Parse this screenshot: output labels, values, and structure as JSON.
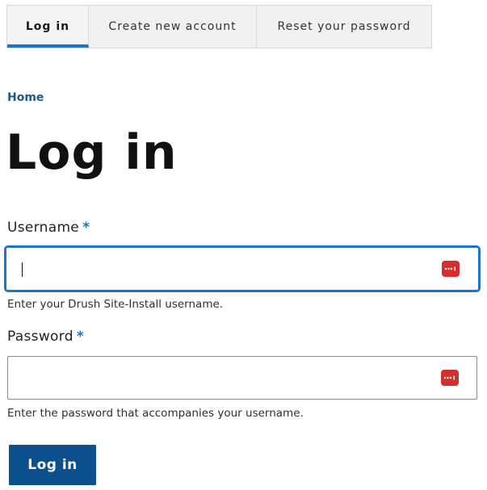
{
  "tabs": [
    {
      "label": "Log in",
      "active": true
    },
    {
      "label": "Create new account",
      "active": false
    },
    {
      "label": "Reset your password",
      "active": false
    }
  ],
  "breadcrumb": {
    "home_label": "Home"
  },
  "page_title": "Log in",
  "form": {
    "username": {
      "label": "Username",
      "required_marker": "*",
      "value": "",
      "description": "Enter your Drush Site-Install username."
    },
    "password": {
      "label": "Password",
      "required_marker": "*",
      "value": "",
      "description": "Enter the password that accompanies your username."
    },
    "submit_label": "Log in"
  },
  "colors": {
    "accent": "#1b74c9",
    "button_bg": "#0b4f8c",
    "link": "#1a5a8e",
    "password_manager_icon": "#d32f2f"
  },
  "icons": {
    "password_manager": "password-manager-icon"
  }
}
